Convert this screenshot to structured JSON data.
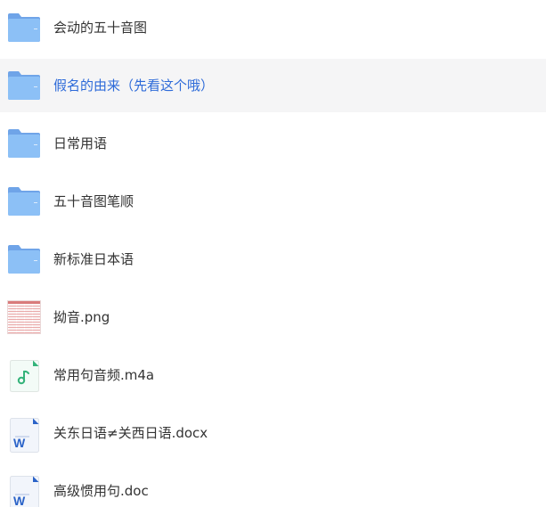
{
  "files": [
    {
      "name": "会动的五十音图",
      "type": "folder-icon",
      "highlighted": false
    },
    {
      "name": "假名的由来（先看这个哦）",
      "type": "folder-icon",
      "highlighted": true
    },
    {
      "name": "日常用语",
      "type": "folder-icon",
      "highlighted": false
    },
    {
      "name": "五十音图笔顺",
      "type": "folder-icon",
      "highlighted": false
    },
    {
      "name": "新标准日本语",
      "type": "folder-icon",
      "highlighted": false
    },
    {
      "name": "拗音.png",
      "type": "image-thumbnail-icon",
      "highlighted": false
    },
    {
      "name": "常用句音频.m4a",
      "type": "audio-file-icon",
      "highlighted": false
    },
    {
      "name": "关东日语≠关西日语.docx",
      "type": "word-doc-icon",
      "highlighted": false
    },
    {
      "name": "高级惯用句.doc",
      "type": "word-doc-icon",
      "highlighted": false
    }
  ],
  "colors": {
    "folder": "#7fb2f0",
    "highlight_bg": "#f5f5f6",
    "highlight_text": "#2e6bd9",
    "text": "#333333",
    "audio": "#34b37a",
    "word": "#2b63c8"
  }
}
